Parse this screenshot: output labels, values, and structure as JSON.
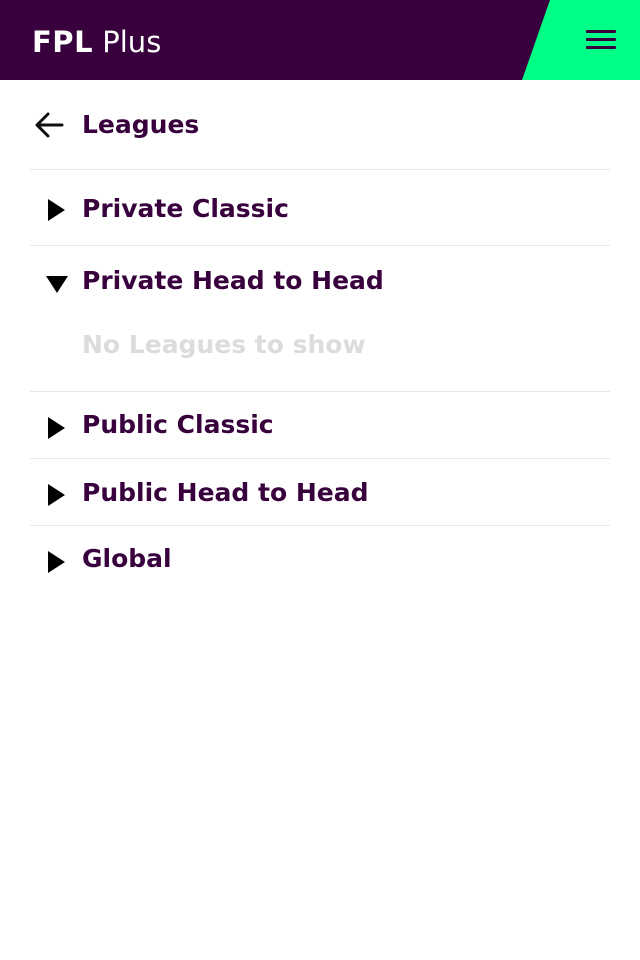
{
  "header": {
    "brand_bold": "FPL",
    "brand_light": "Plus",
    "menu_icon": "hamburger-menu-icon",
    "colors": {
      "primary": "#38003c",
      "accent": "#00ff87"
    }
  },
  "page": {
    "title": "Leagues",
    "back_icon": "arrow-left-icon"
  },
  "sections": [
    {
      "label": "Private Classic",
      "expanded": false
    },
    {
      "label": "Private Head to Head",
      "expanded": true,
      "empty_message": "No Leagues to show"
    },
    {
      "label": "Public Classic",
      "expanded": false
    },
    {
      "label": "Public Head to Head",
      "expanded": false
    },
    {
      "label": "Global",
      "expanded": false
    }
  ]
}
